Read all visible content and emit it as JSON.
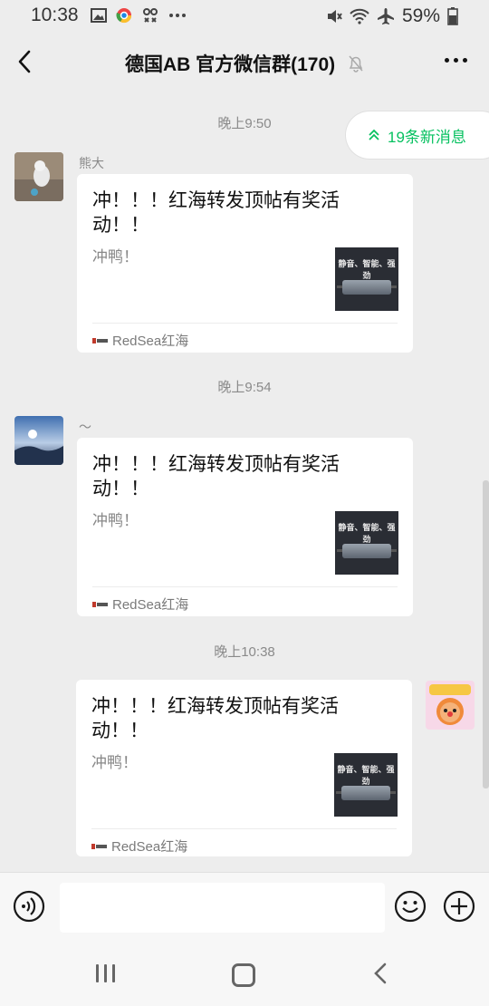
{
  "status_bar": {
    "time": "10:38",
    "battery": "59%",
    "left_icons": [
      "gallery-icon",
      "chrome-icon",
      "voicemail-icon",
      "more-dots-icon"
    ],
    "right_icons": [
      "mute-icon",
      "wifi-icon",
      "airplane-icon",
      "battery-icon"
    ]
  },
  "header": {
    "title": "德国AB  官方微信群(170)",
    "back_icon": "back-icon",
    "mute_icon": "bell-off-icon",
    "more_icon": "more-icon"
  },
  "new_messages": {
    "label": "19条新消息",
    "icon": "double-chevron-up-icon"
  },
  "messages": [
    {
      "time": "晚上9:50",
      "sender": "熊大",
      "side": "left",
      "card": {
        "title": "冲！！！红海转发顶帖有奖活动！！",
        "description": "冲鸭！",
        "source": "RedSea红海",
        "thumb_text": "静音、智能、强劲"
      }
    },
    {
      "time": "晚上9:54",
      "sender": "～",
      "side": "left",
      "card": {
        "title": "冲！！！红海转发顶帖有奖活动！！",
        "description": "冲鸭！",
        "source": "RedSea红海",
        "thumb_text": "静音、智能、强劲"
      }
    },
    {
      "time": "晚上10:38",
      "sender": "",
      "side": "right",
      "card": {
        "title": "冲！！！红海转发顶帖有奖活动！！",
        "description": "冲鸭！",
        "source": "RedSea红海",
        "thumb_text": "静音、智能、强劲"
      }
    }
  ],
  "input_bar": {
    "voice_icon": "voice-icon",
    "emoji_icon": "emoji-icon",
    "plus_icon": "plus-icon"
  },
  "nav_bar": {
    "icons": [
      "recents-icon",
      "home-icon",
      "back-nav-icon"
    ]
  },
  "colors": {
    "accent": "#07c160",
    "background": "#ededed",
    "card": "#ffffff"
  }
}
